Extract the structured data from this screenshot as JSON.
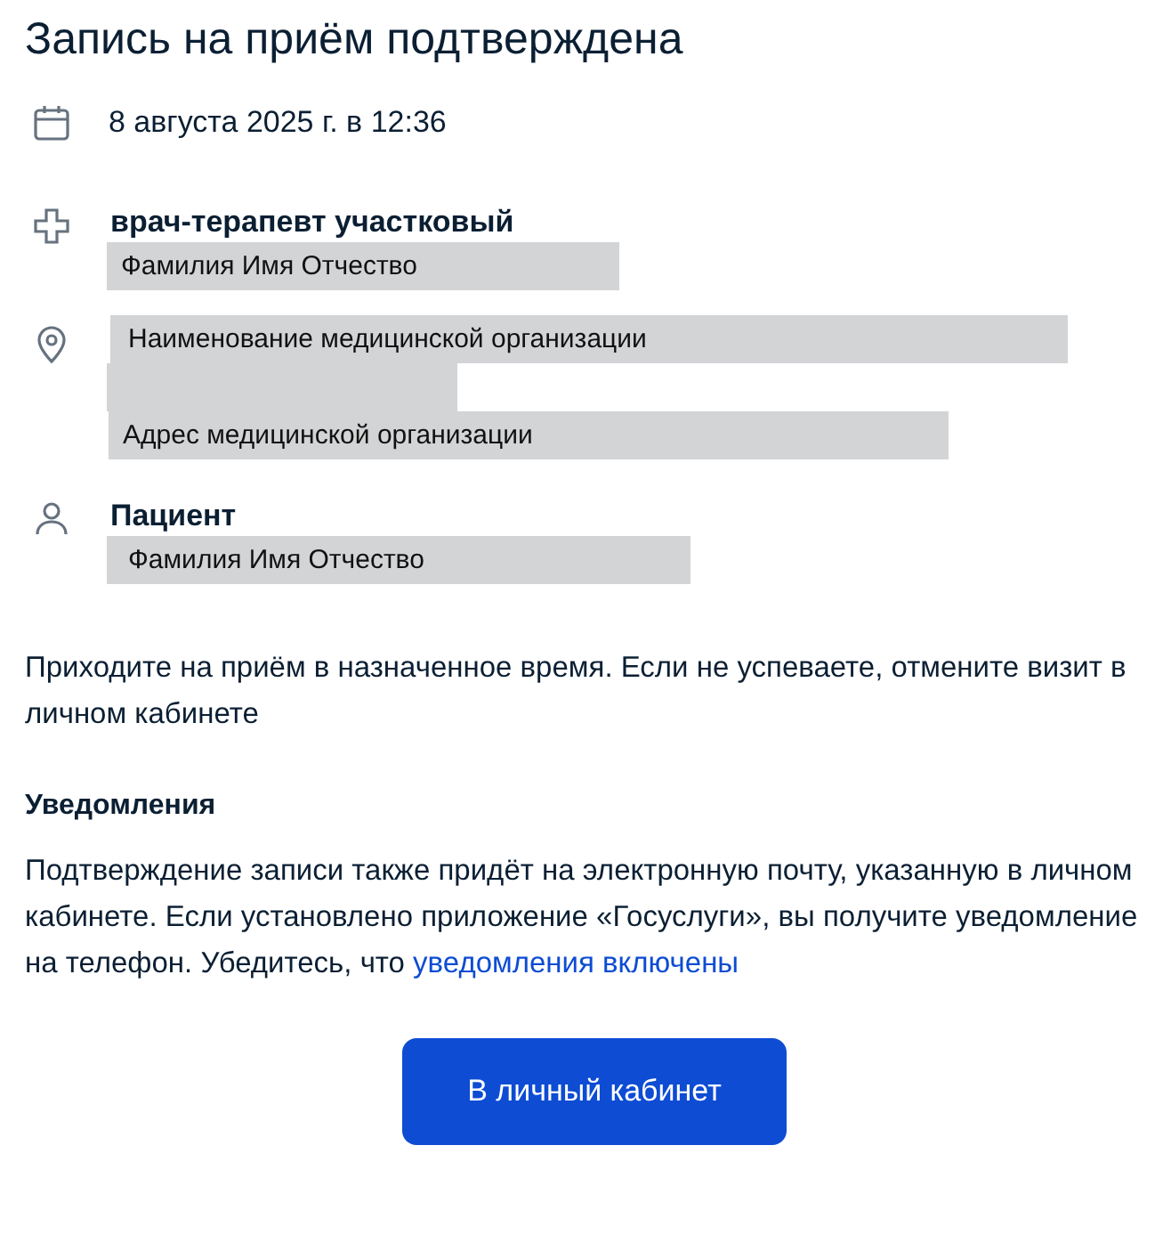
{
  "title": "Запись на приём подтверждена",
  "date": "8 августа 2025 г. в 12:36",
  "doctor": {
    "specialty": "врач-терапевт участковый",
    "name": "Фамилия Имя Отчество"
  },
  "organization": {
    "name": "Наименование медицинской организации",
    "address": "Адрес медицинской организации"
  },
  "patient": {
    "label": "Пациент",
    "name": "Фамилия Имя Отчество"
  },
  "notice": "Приходите на приём в назначенное время. Если не успеваете, отмените визит в личном кабинете",
  "notifications": {
    "heading": "Уведомления",
    "text": "Подтверждение записи также придёт на электронную почту, указанную в личном кабинете. Если установлено приложение «Госуслуги», вы получите уведомление на телефон. Убедитесь, что",
    "link": "уведомления включены"
  },
  "button": "В личный кабинет"
}
